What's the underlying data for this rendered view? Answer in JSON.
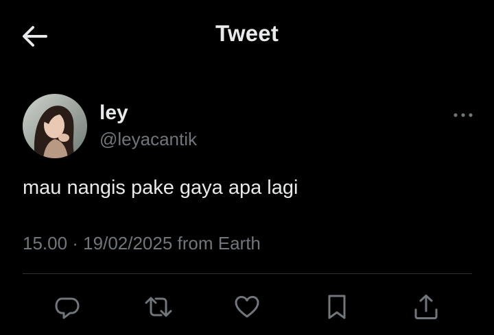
{
  "header": {
    "title": "Tweet",
    "back_icon": "arrow-left-icon"
  },
  "tweet": {
    "author": {
      "display_name": "ley",
      "handle": "@leyacantik",
      "avatar_icon": "profile-photo"
    },
    "more_icon": "more-horizontal-icon",
    "text": "mau nangis pake gaya apa lagi",
    "meta": "15.00 · 19/02/2025 from Earth"
  },
  "actions": [
    {
      "name": "reply",
      "icon": "reply-icon"
    },
    {
      "name": "retweet",
      "icon": "retweet-icon"
    },
    {
      "name": "like",
      "icon": "heart-icon"
    },
    {
      "name": "bookmark",
      "icon": "bookmark-icon"
    },
    {
      "name": "share",
      "icon": "share-icon"
    }
  ],
  "colors": {
    "background": "#000000",
    "primary_text": "#e7e9ea",
    "secondary_text": "#71767b",
    "divider": "#2f3336"
  }
}
